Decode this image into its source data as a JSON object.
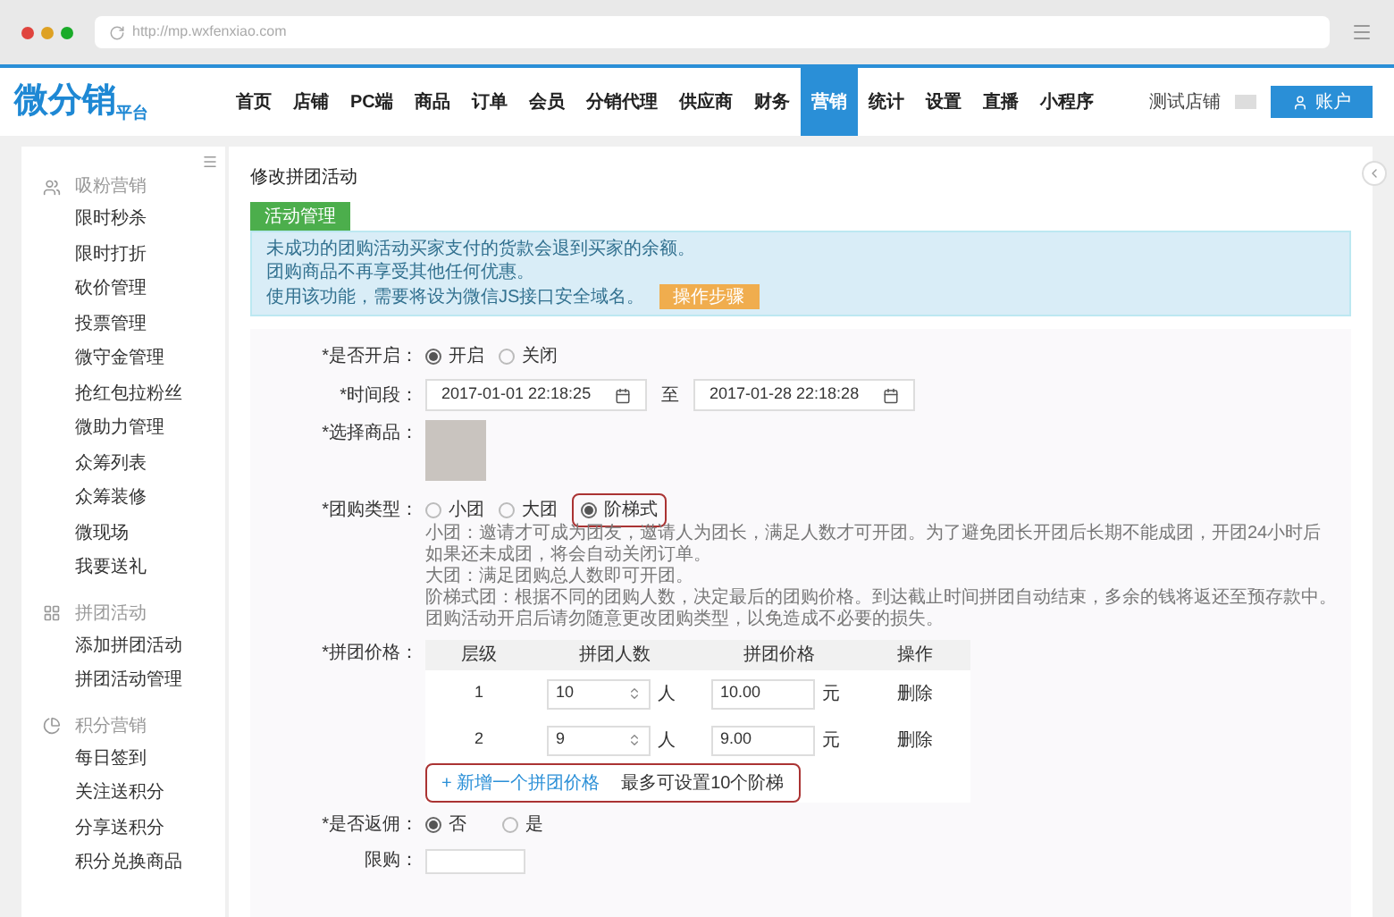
{
  "browser": {
    "url": "http://mp.wxfenxiao.com"
  },
  "header": {
    "logo_main": "微分销",
    "logo_sub": "平台",
    "nav": [
      {
        "label": "首页",
        "selected": false
      },
      {
        "label": "店铺",
        "selected": false
      },
      {
        "label": "PC端",
        "selected": false
      },
      {
        "label": "商品",
        "selected": false
      },
      {
        "label": "订单",
        "selected": false
      },
      {
        "label": "会员",
        "selected": false
      },
      {
        "label": "分销代理",
        "selected": false
      },
      {
        "label": "供应商",
        "selected": false
      },
      {
        "label": "财务",
        "selected": false
      },
      {
        "label": "营销",
        "selected": true
      },
      {
        "label": "统计",
        "selected": false
      },
      {
        "label": "设置",
        "selected": false
      },
      {
        "label": "直播",
        "selected": false
      },
      {
        "label": "小程序",
        "selected": false
      }
    ],
    "store": "测试店铺",
    "account": "账户"
  },
  "sidebar": {
    "groups": [
      {
        "title": "吸粉营销",
        "kind": "users",
        "items": [
          {
            "label": "限时秒杀",
            "selected": false
          },
          {
            "label": "限时打折",
            "selected": false
          },
          {
            "label": "砍价管理",
            "selected": false
          },
          {
            "label": "投票管理",
            "selected": false
          },
          {
            "label": "微守金管理",
            "selected": false
          },
          {
            "label": "抢红包拉粉丝",
            "selected": false
          },
          {
            "label": "微助力管理",
            "selected": false
          },
          {
            "label": "众筹列表",
            "selected": false
          },
          {
            "label": "众筹装修",
            "selected": false
          },
          {
            "label": "微现场",
            "selected": false
          },
          {
            "label": "我要送礼",
            "selected": false
          }
        ]
      },
      {
        "title": "拼团活动",
        "kind": "grid",
        "items": [
          {
            "label": "添加拼团活动",
            "selected": false
          },
          {
            "label": "拼团活动管理",
            "selected": false
          }
        ]
      },
      {
        "title": "积分营销",
        "kind": "pie",
        "items": [
          {
            "label": "每日签到",
            "selected": false
          },
          {
            "label": "关注送积分",
            "selected": false
          },
          {
            "label": "分享送积分",
            "selected": false
          },
          {
            "label": "积分兑换商品",
            "selected": false
          }
        ]
      }
    ]
  },
  "page": {
    "title": "修改拼团活动",
    "tab": "活动管理",
    "notice": {
      "lines": [
        "未成功的团购活动买家支付的货款会退到买家的余额。",
        "团购商品不再享受其他任何优惠。",
        "使用该功能，需要将设为微信JS接口安全域名。"
      ],
      "button": "操作步骤"
    },
    "form": {
      "enabled": {
        "label": "*是否开启：",
        "options": [
          {
            "label": "开启",
            "selected": true
          },
          {
            "label": "关闭",
            "selected": false
          }
        ]
      },
      "period": {
        "label": "*时间段：",
        "start": "2017-01-01 22:18:25",
        "separator": "至",
        "end": "2017-01-28 22:18:28"
      },
      "product": {
        "label": "*选择商品："
      },
      "type": {
        "label": "*团购类型：",
        "options": [
          {
            "label": "小团",
            "selected": false
          },
          {
            "label": "大团",
            "selected": false
          },
          {
            "label": "阶梯式",
            "selected": true
          }
        ],
        "descriptions": [
          "小团：邀请才可成为团友，邀请人为团长，满足人数才可开团。为了避免团长开团后长期不能成团，开团24小时后如果还未成团，将会自动关闭订单。",
          "大团：满足团购总人数即可开团。",
          "阶梯式团：根据不同的团购人数，决定最后的团购价格。到达截止时间拼团自动结束，多余的钱将返还至预存款中。",
          "团购活动开启后请勿随意更改团购类型，以免造成不必要的损失。"
        ]
      },
      "price": {
        "label": "*拼团价格：",
        "columns": [
          "层级",
          "拼团人数",
          "拼团价格",
          "操作"
        ],
        "rows": [
          {
            "level": "1",
            "count": "10",
            "count_unit": "人",
            "price": "10.00",
            "price_unit": "元",
            "action": "删除"
          },
          {
            "level": "2",
            "count": "9",
            "count_unit": "人",
            "price": "9.00",
            "price_unit": "元",
            "action": "删除"
          }
        ],
        "add_link": "+ 新增一个拼团价格",
        "add_hint": "最多可设置10个阶梯"
      },
      "rebate": {
        "label": "*是否返佣：",
        "options": [
          {
            "label": "否",
            "selected": true
          },
          {
            "label": "是",
            "selected": false
          }
        ]
      },
      "limit": {
        "label": "限购："
      }
    }
  }
}
